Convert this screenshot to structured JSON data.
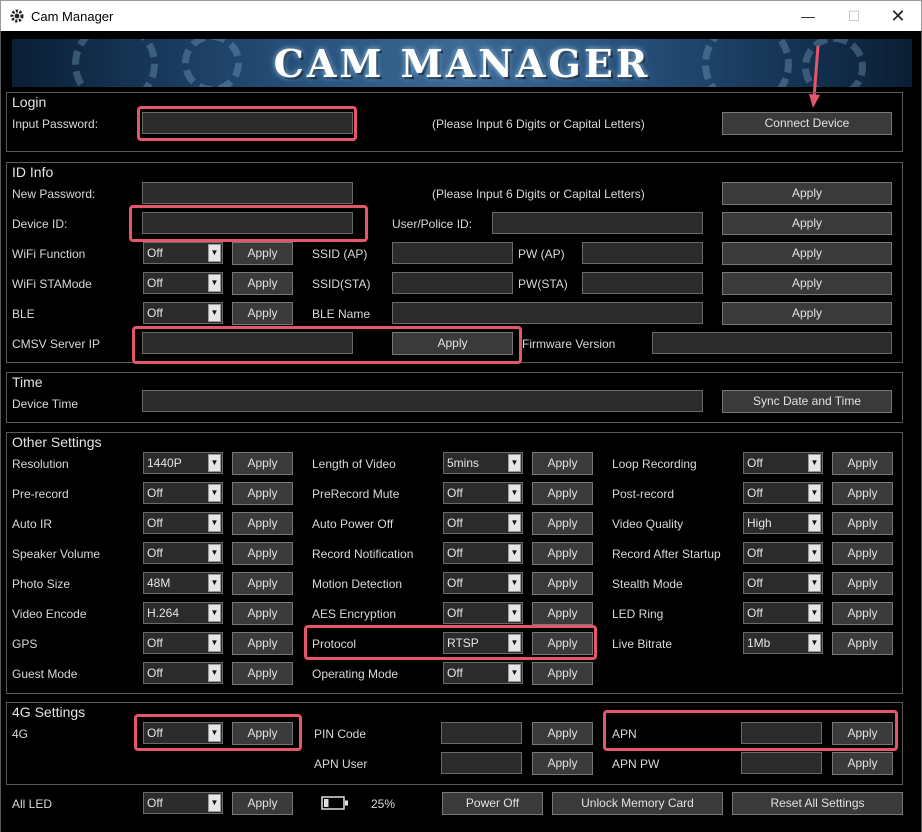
{
  "window": {
    "title": "Cam Manager",
    "minimize": "—",
    "maximize": "☐",
    "close": "✕"
  },
  "banner": {
    "title": "CAM MANAGER"
  },
  "login": {
    "title": "Login",
    "password_label": "Input Password:",
    "password_value": "",
    "hint": "(Please Input 6 Digits or Capital Letters)",
    "connect_label": "Connect Device"
  },
  "id_info": {
    "title": "ID Info",
    "new_password_label": "New Password:",
    "new_password_hint": "(Please Input 6 Digits or Capital Letters)",
    "device_id_label": "Device ID:",
    "user_police_label": "User/Police ID:",
    "wifi_function_label": "WiFi Function",
    "wifi_function_value": "Off",
    "ssid_ap_label": "SSID (AP)",
    "pw_ap_label": "PW (AP)",
    "wifi_sta_label": "WiFi STAMode",
    "wifi_sta_value": "Off",
    "ssid_sta_label": "SSID(STA)",
    "pw_sta_label": "PW(STA)",
    "ble_label": "BLE",
    "ble_value": "Off",
    "ble_name_label": "BLE Name",
    "cmsv_label": "CMSV Server IP",
    "firmware_label": "Firmware Version",
    "apply": "Apply"
  },
  "time": {
    "title": "Time",
    "device_time_label": "Device Time",
    "sync_label": "Sync Date and Time"
  },
  "other": {
    "title": "Other Settings",
    "apply": "Apply",
    "col1": [
      {
        "label": "Resolution",
        "value": "1440P"
      },
      {
        "label": "Pre-record",
        "value": "Off"
      },
      {
        "label": "Auto IR",
        "value": "Off"
      },
      {
        "label": "Speaker Volume",
        "value": "Off"
      },
      {
        "label": "Photo Size",
        "value": "48M"
      },
      {
        "label": "Video Encode",
        "value": "H.264"
      },
      {
        "label": "GPS",
        "value": "Off"
      },
      {
        "label": "Guest Mode",
        "value": "Off"
      }
    ],
    "col2": [
      {
        "label": "Length of Video",
        "value": "5mins"
      },
      {
        "label": "PreRecord Mute",
        "value": "Off"
      },
      {
        "label": "Auto Power Off",
        "value": "Off"
      },
      {
        "label": "Record Notification",
        "value": "Off"
      },
      {
        "label": "Motion Detection",
        "value": "Off"
      },
      {
        "label": "AES Encryption",
        "value": "Off"
      },
      {
        "label": "Protocol",
        "value": "RTSP"
      },
      {
        "label": "Operating Mode",
        "value": "Off"
      }
    ],
    "col3": [
      {
        "label": "Loop Recording",
        "value": "Off"
      },
      {
        "label": "Post-record",
        "value": "Off"
      },
      {
        "label": "Video Quality",
        "value": "High"
      },
      {
        "label": "Record After Startup",
        "value": "Off"
      },
      {
        "label": "Stealth Mode",
        "value": "Off"
      },
      {
        "label": "LED Ring",
        "value": "Off"
      },
      {
        "label": "Live Bitrate",
        "value": "1Mb"
      }
    ]
  },
  "g4": {
    "title": "4G Settings",
    "g4_label": "4G",
    "g4_value": "Off",
    "pin_label": "PIN Code",
    "apn_user_label": "APN User",
    "apn_label": "APN",
    "apn_pw_label": "APN PW",
    "apply": "Apply"
  },
  "bottom": {
    "all_led_label": "All LED",
    "all_led_value": "Off",
    "apply": "Apply",
    "battery_pct": "25%",
    "power_off_label": "Power Off",
    "unlock_label": "Unlock Memory Card",
    "reset_label": "Reset All Settings"
  },
  "colors": {
    "background": "#000000",
    "highlight": "#e4566a",
    "field": "#2b2b2b",
    "button": "#3a3a3a"
  }
}
